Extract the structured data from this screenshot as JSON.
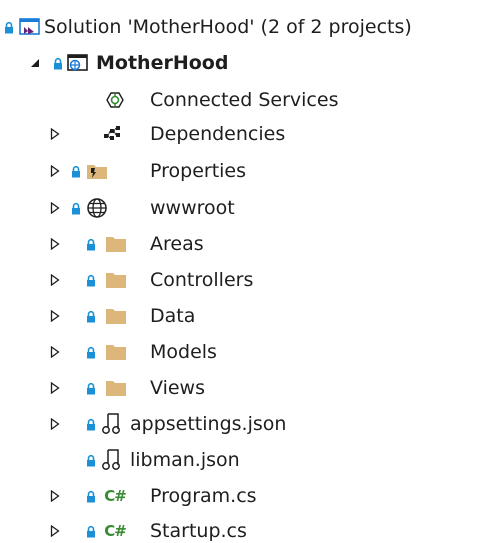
{
  "solution_explorer": {
    "solution": {
      "label": "Solution 'MotherHood' (2 of 2 projects)"
    },
    "project": {
      "label": "MotherHood"
    },
    "items": [
      {
        "label": "Connected Services",
        "icon": "connected-services-icon",
        "expandable": false,
        "locked": false
      },
      {
        "label": "Dependencies",
        "icon": "dependencies-icon",
        "expandable": true,
        "locked": false
      },
      {
        "label": "Properties",
        "icon": "properties-folder-icon",
        "expandable": true,
        "locked": true
      },
      {
        "label": "wwwroot",
        "icon": "globe-icon",
        "expandable": true,
        "locked": true
      },
      {
        "label": "Areas",
        "icon": "folder-icon",
        "expandable": true,
        "locked": true
      },
      {
        "label": "Controllers",
        "icon": "folder-icon",
        "expandable": true,
        "locked": true
      },
      {
        "label": "Data",
        "icon": "folder-icon",
        "expandable": true,
        "locked": true
      },
      {
        "label": "Models",
        "icon": "folder-icon",
        "expandable": true,
        "locked": true
      },
      {
        "label": "Views",
        "icon": "folder-icon",
        "expandable": true,
        "locked": true
      },
      {
        "label": "appsettings.json",
        "icon": "json-file-icon",
        "expandable": true,
        "locked": true
      },
      {
        "label": "libman.json",
        "icon": "json-file-icon",
        "expandable": false,
        "locked": true
      },
      {
        "label": "Program.cs",
        "icon": "csharp-file-icon",
        "icon_text": "C#",
        "expandable": true,
        "locked": true
      },
      {
        "label": "Startup.cs",
        "icon": "csharp-file-icon",
        "icon_text": "C#",
        "expandable": true,
        "locked": true
      }
    ],
    "colors": {
      "text": "#1e1e1e",
      "folder": "#dcb67a",
      "lock": "#1b90d8",
      "csharp": "#388a34",
      "expander": "#1e1e1e",
      "project_blue": "#1b7bd8",
      "vs_purple": "#68217a"
    }
  }
}
